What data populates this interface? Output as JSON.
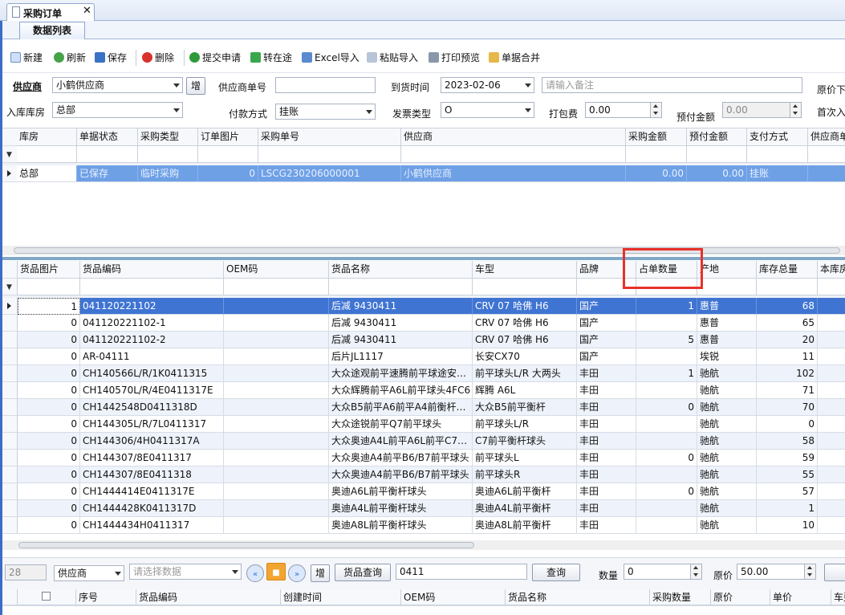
{
  "tabs": {
    "document_tab": "采购订单",
    "sub_tab": "数据列表"
  },
  "toolbar": [
    "新建",
    "刷新",
    "保存",
    "删除",
    "提交申请",
    "转在途",
    "Excel导入",
    "粘贴导入",
    "打印预览",
    "单据合并"
  ],
  "form": {
    "supplier_label": "供应商",
    "supplier_value": "小鹤供应商",
    "add_btn": "增",
    "supplier_no_label": "供应商单号",
    "supplier_no_value": "",
    "arrival_label": "到货时间",
    "arrival_value": "2023-02-06",
    "remark_placeholder": "请输入备注",
    "orig_price_label": "原价下",
    "warehouse_label": "入库库房",
    "warehouse_value": "总部",
    "payment_label": "付款方式",
    "payment_value": "挂账",
    "invoice_label": "发票类型",
    "invoice_value": "O",
    "pack_label": "打包费",
    "pack_value": "0.00",
    "prepay_label": "预付金额",
    "prepay_value": "0.00",
    "first_in_label": "首次入"
  },
  "order_grid": {
    "columns": [
      "库房",
      "单据状态",
      "采购类型",
      "订单图片",
      "采购单号",
      "供应商",
      "采购金额",
      "预付金额",
      "支付方式",
      "供应商单"
    ],
    "rows": [
      [
        "总部",
        "已保存",
        "临时采购",
        "0",
        "LSCG230206000001",
        "小鹤供应商",
        "0.00",
        "0.00",
        "挂账",
        ""
      ]
    ]
  },
  "goods_grid": {
    "columns": [
      "货品图片",
      "货品编码",
      "OEM码",
      "货品名称",
      "车型",
      "品牌",
      "占单数量",
      "产地",
      "库存总量",
      "本库房"
    ],
    "rows": [
      [
        "1",
        "041120221102",
        "",
        "后减 9430411",
        "CRV 07 哈佛 H6",
        "国产",
        "1",
        "惠普",
        "68"
      ],
      [
        "0",
        "041120221102-1",
        "",
        "后减 9430411",
        "CRV 07 哈佛 H6",
        "国产",
        "",
        "惠普",
        "65"
      ],
      [
        "0",
        "041120221102-2",
        "",
        "后减 9430411",
        "CRV 07 哈佛 H6",
        "国产",
        "5",
        "惠普",
        "20"
      ],
      [
        "0",
        "AR-04111",
        "",
        "后片JL1117",
        "长安CX70",
        "国产",
        "",
        "埃锐",
        "11"
      ],
      [
        "0",
        "CH140566L/R/1K0411315",
        "",
        "大众途观前平速腾前平球途安…",
        "前平球头L/R 大两头",
        "丰田",
        "1",
        "驰航",
        "102"
      ],
      [
        "0",
        "CH140570L/R/4E0411317E",
        "",
        "大众辉腾前平A6L前平球头4FC6",
        "辉腾 A6L",
        "丰田",
        "",
        "驰航",
        "71"
      ],
      [
        "0",
        "CH1442548D0411318D",
        "",
        "大众B5前平A6前平A4前衡杆…",
        "大众B5前平衡杆",
        "丰田",
        "0",
        "驰航",
        "70"
      ],
      [
        "0",
        "CH144305L/R/7L0411317",
        "",
        "大众途锐前平Q7前平球头",
        "前平球头L/R",
        "丰田",
        "",
        "驰航",
        "0"
      ],
      [
        "0",
        "CH144306/4H0411317A",
        "",
        "大众奥迪A4L前平A6L前平C7…",
        "C7前平衡杆球头",
        "丰田",
        "",
        "驰航",
        "58"
      ],
      [
        "0",
        "CH144307/8E0411317",
        "",
        "大众奥迪A4前平B6/B7前平球头",
        "前平球头L",
        "丰田",
        "0",
        "驰航",
        "59"
      ],
      [
        "0",
        "CH144307/8E0411318",
        "",
        "大众奥迪A4前平B6/B7前平球头",
        "前平球头R",
        "丰田",
        "",
        "驰航",
        "55"
      ],
      [
        "0",
        "CH1444414E0411317E",
        "",
        "奥迪A6L前平衡杆球头",
        "奥迪A6L前平衡杆",
        "丰田",
        "0",
        "驰航",
        "57"
      ],
      [
        "0",
        "CH1444428K0411317D",
        "",
        "奥迪A4L前平衡杆球头",
        "奥迪A4L前平衡杆",
        "丰田",
        "",
        "驰航",
        "1"
      ],
      [
        "0",
        "CH1444434H0411317",
        "",
        "奥迪A8L前平衡杆球头",
        "奥迪A8L前平衡杆",
        "丰田",
        "",
        "驰航",
        "10"
      ]
    ]
  },
  "query_bar": {
    "count": "28",
    "field_value": "供应商",
    "select_placeholder": "请选择数据",
    "add_btn": "增",
    "goods_query_label": "货品查询",
    "query_input": "0411",
    "query_btn": "查询",
    "qty_label": "数量",
    "qty_value": "0",
    "price_label": "原价",
    "price_value": "50.00"
  },
  "detail_grid": {
    "columns": [
      "序号",
      "货品编码",
      "创建时间",
      "OEM码",
      "货品名称",
      "采购数量",
      "原价",
      "单价",
      "车型"
    ]
  }
}
